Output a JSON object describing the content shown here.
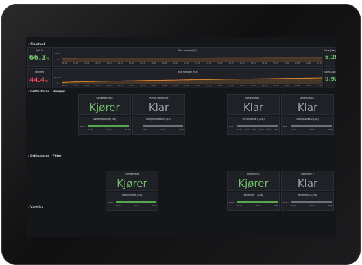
{
  "colors": {
    "green": "#73bf69",
    "red": "#f2495c",
    "grey": "#9fa2a8",
    "bar_green": "#56a64b",
    "bar_grey": "#6e7076",
    "line_orange": "#ff9830"
  },
  "sections": {
    "elevation": "› Slamtank",
    "pumps": "› Driftsstatus - Pumper",
    "filters": "› Driftsstatus - Filter",
    "valves": "› Ventiler"
  },
  "tank_pct": {
    "title": "Tank %",
    "value": "66.3",
    "unit": "%"
  },
  "tank_m3": {
    "title": "Tank m3",
    "value": "44.4",
    "unit": "m³"
  },
  "chart_pct": {
    "title": "Tank mengde (%)",
    "ylabels": [
      "100%",
      "0%"
    ],
    "times": [
      "08:00",
      "08:45",
      "09:00",
      "09:15",
      "09:30",
      "09:45",
      "10:00",
      "10:15",
      "10:30",
      "10:45",
      "11:00",
      "11:15",
      "11:30",
      "11:45",
      "12:00",
      "12:15",
      "12:30",
      "12:45",
      "13:00",
      "13:15",
      "13:30",
      "13:45",
      "14:00",
      "14:15"
    ]
  },
  "chart_m3": {
    "title": "Tank mengde (m3)",
    "ylabels": [
      "62.5 m3",
      "0"
    ],
    "times": [
      "08:00",
      "08:45",
      "09:00",
      "09:15",
      "09:30",
      "09:45",
      "10:00",
      "10:15",
      "10:30",
      "10:45",
      "11:00",
      "11:15",
      "11:30",
      "11:45",
      "12:00",
      "12:15",
      "12:30",
      "12:45",
      "13:00",
      "13:15",
      "13:30",
      "13:45",
      "14:00",
      "14:15"
    ]
  },
  "stem_day": {
    "title": "Slam (døg)",
    "value": "6.29",
    "unit": "m³"
  },
  "stem_24h": {
    "title": "Slam (24t)",
    "value": "9.92",
    "unit": "m³"
  },
  "pumps": [
    {
      "title": "Sjønærepumpe",
      "state": "Kjører",
      "hist_title": "Sjønærepumpe (24t)",
      "status": "Status",
      "times": [
        "16:00",
        "00:00",
        "08:00"
      ]
    },
    {
      "title": "Pumpe holdetank",
      "state": "Klar",
      "hist_title": "Pumpe holdetank (24t)",
      "status": "",
      "times": [
        "16:00",
        "00:00",
        "08:00"
      ]
    },
    {
      "title": "Skruepumpe 1",
      "state": "Klar",
      "hist_title": "Skruepumpe 1 (24t)",
      "status": "Drift",
      "times": [
        "16:00",
        "20:00",
        "00:00",
        "04:00",
        "08:00",
        "12:00"
      ]
    },
    {
      "title": "Skruepumpe 2",
      "state": "Klar",
      "hist_title": "Skruepumpe 2 (24t)",
      "status": "Drift",
      "times": [
        "16:00",
        "00:00",
        "08:00"
      ]
    }
  ],
  "filters": [
    {
      "title": "Trommelfilter",
      "state": "Kjører",
      "hist_title": "Trommelfilter (24t)",
      "status": "Status",
      "times": [
        "16:00",
        "00:00",
        "08:00"
      ]
    },
    {
      "title": "Beltefilter 1",
      "state": "Kjører",
      "hist_title": "Beltefilter 1 (24t)",
      "status": "Status",
      "times": [
        "16:00",
        "00:00",
        "08:00"
      ]
    },
    {
      "title": "Beltefilter 2",
      "state": "Klar",
      "hist_title": "Beltefilter 2 (24t)",
      "status": "Status",
      "times": [
        "16:00",
        "00:00",
        "08:00"
      ]
    }
  ]
}
